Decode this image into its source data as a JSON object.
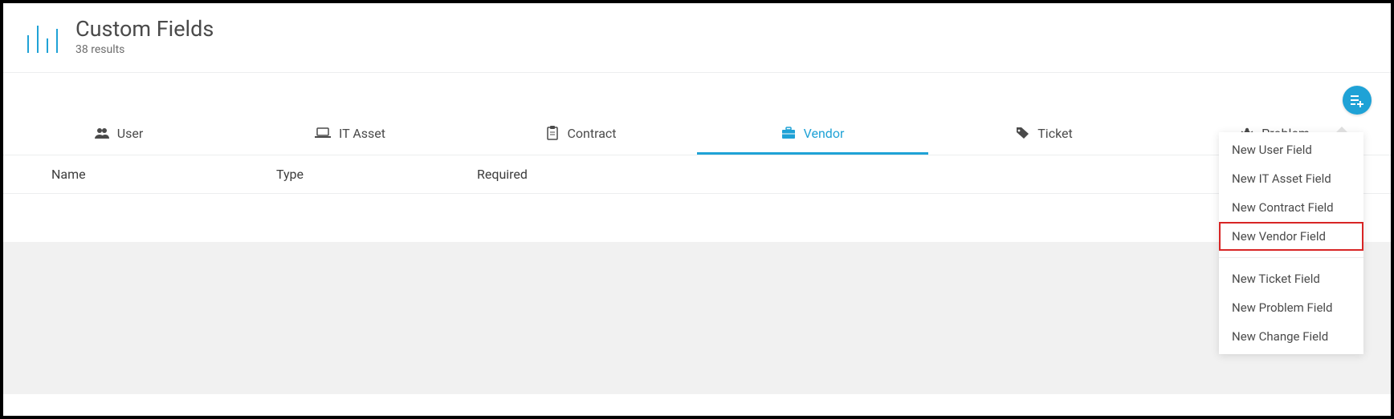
{
  "header": {
    "title": "Custom Fields",
    "subtitle": "38 results"
  },
  "tabs": [
    {
      "icon": "users-icon",
      "label": "User",
      "active": false
    },
    {
      "icon": "laptop-icon",
      "label": "IT Asset",
      "active": false
    },
    {
      "icon": "clipboard-icon",
      "label": "Contract",
      "active": false
    },
    {
      "icon": "briefcase-icon",
      "label": "Vendor",
      "active": true
    },
    {
      "icon": "tag-icon",
      "label": "Ticket",
      "active": false
    },
    {
      "icon": "bug-icon",
      "label": "Problem",
      "active": false
    }
  ],
  "columns": {
    "name": "Name",
    "type": "Type",
    "required": "Required"
  },
  "dropdown": {
    "groups": [
      [
        {
          "label": "New User Field",
          "highlight": false
        },
        {
          "label": "New IT Asset Field",
          "highlight": false
        },
        {
          "label": "New Contract Field",
          "highlight": false
        },
        {
          "label": "New Vendor Field",
          "highlight": true
        }
      ],
      [
        {
          "label": "New Ticket Field",
          "highlight": false
        },
        {
          "label": "New Problem Field",
          "highlight": false
        },
        {
          "label": "New Change Field",
          "highlight": false
        }
      ]
    ]
  }
}
